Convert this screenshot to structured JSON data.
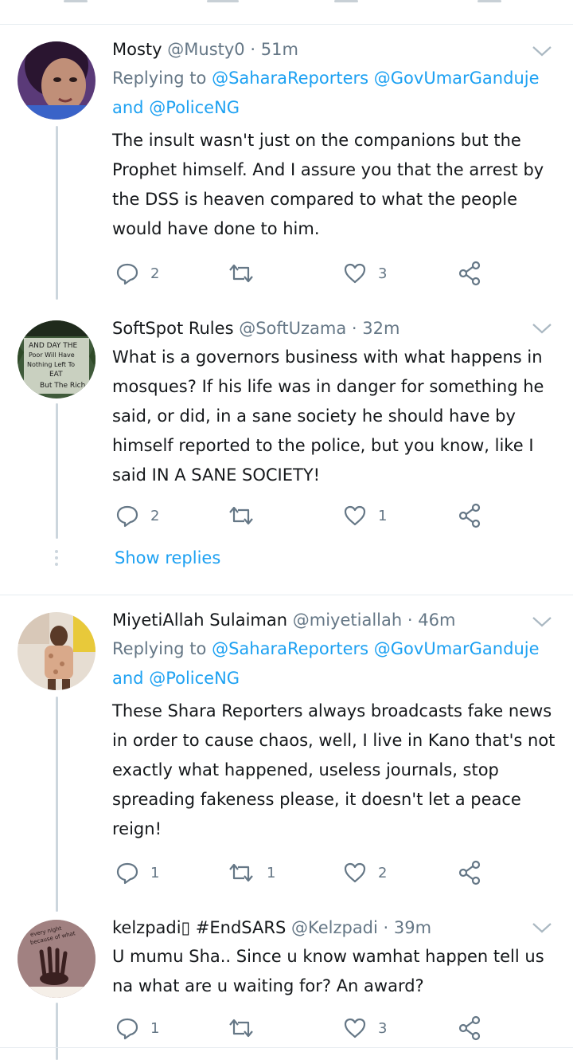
{
  "colors": {
    "accent": "#1da1f2",
    "secondary_text": "#657786",
    "primary_text": "#14171a",
    "divider": "#e6ecf0"
  },
  "tweets": [
    {
      "name": "Mosty",
      "handle": "@Musty0",
      "time": "51m",
      "replying_label": "Replying to",
      "mentions": [
        "@SaharaReporters",
        "@GovUmarGanduje",
        "@PoliceNG"
      ],
      "and": "and",
      "text": "The insult wasn't just on the companions but the Prophet himself. And I assure you that the arrest by the DSS is heaven compared to what the people would have done to him.",
      "replies": "2",
      "retweets": "",
      "likes": "3"
    },
    {
      "name": "SoftSpot Rules",
      "handle": "@SoftUzama",
      "time": "32m",
      "avatar_text": [
        "AND DAY THE",
        "Poor Will Have",
        "Nothing Left To",
        "EAT",
        "But The Rich"
      ],
      "text": "What is a governors business with what happens in mosques? If his life was in danger for something he said, or did, in a sane society he should have by himself reported to the police, but you know, like I said IN A SANE SOCIETY!",
      "replies": "2",
      "retweets": "",
      "likes": "1"
    },
    {
      "name": "MiyetiAllah Sulaiman",
      "handle": "@miyetiallah",
      "time": "46m",
      "replying_label": "Replying to",
      "mentions": [
        "@SaharaReporters",
        "@GovUmarGanduje",
        "@PoliceNG"
      ],
      "and": "and",
      "text": "These Shara Reporters always broadcasts fake news in order to cause chaos, well, I live in Kano that's not exactly what happened, useless journals, stop spreading fakeness please, it doesn't let a peace reign!",
      "replies": "1",
      "retweets": "1",
      "likes": "2"
    },
    {
      "name": "kelzpadi▯ #EndSARS",
      "handle": "@Kelzpadi",
      "time": "39m",
      "avatar_text": [
        "every night",
        "because of what"
      ],
      "text": "U mumu Sha.. Since u know wamhat happen tell us na what are u waiting for? An award?",
      "replies": "1",
      "retweets": "",
      "likes": "3"
    }
  ],
  "show_replies": "Show replies",
  "separator_dot": "·",
  "icons": [
    "reply-icon",
    "retweet-icon",
    "like-icon",
    "share-icon",
    "chevron-down-icon"
  ]
}
